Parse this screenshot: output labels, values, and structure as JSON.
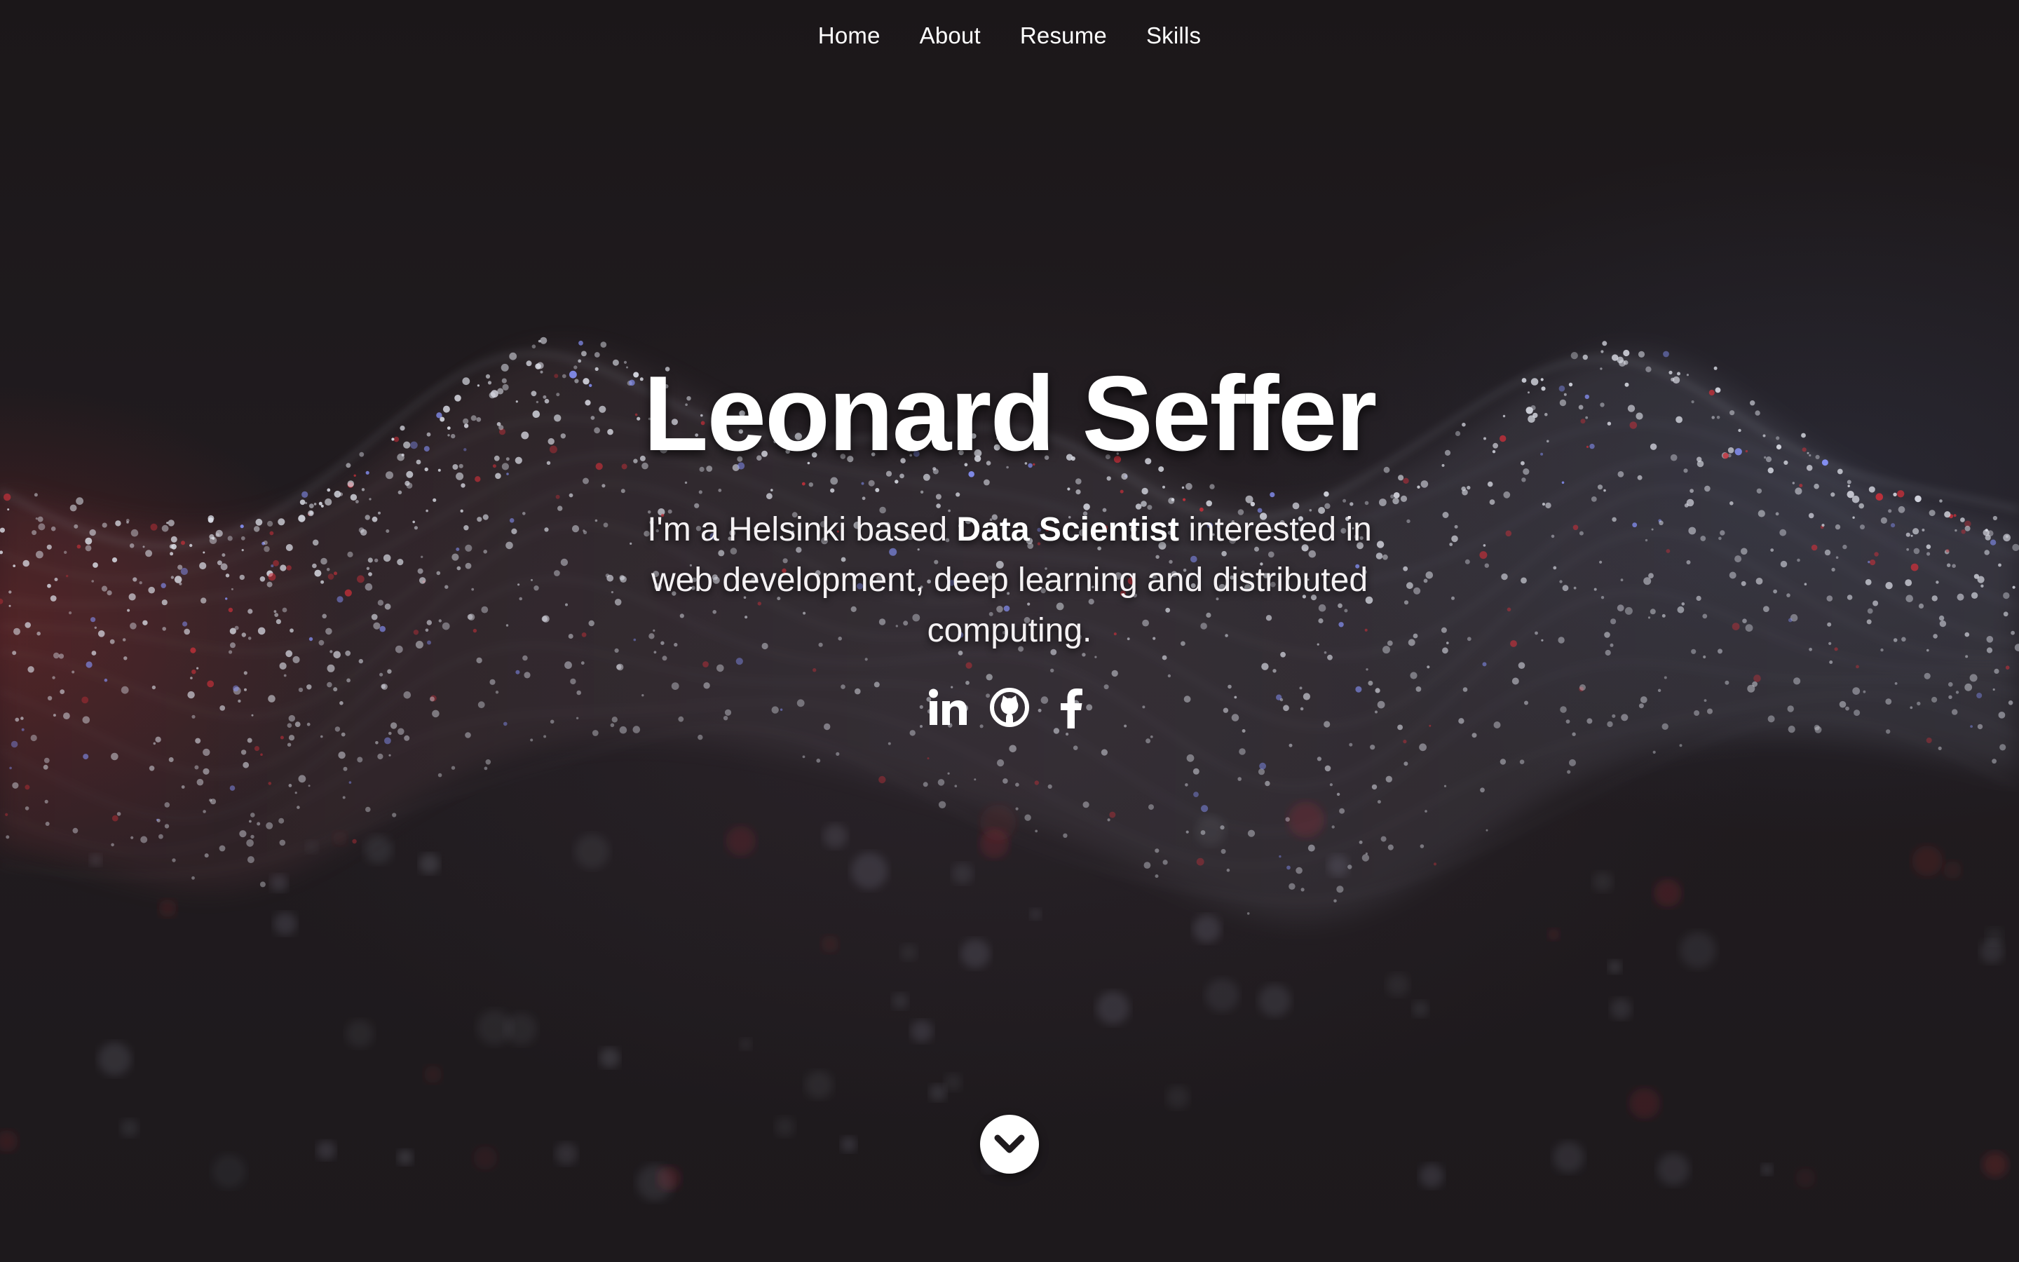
{
  "nav": {
    "items": [
      {
        "label": "Home"
      },
      {
        "label": "About"
      },
      {
        "label": "Resume"
      },
      {
        "label": "Skills"
      }
    ]
  },
  "banner": {
    "name": "Leonard Seffer",
    "intro_before": "I'm a Helsinki based ",
    "intro_emphasis": "Data Scientist",
    "intro_after": " interested in web development, deep learning and distributed computing."
  },
  "social": {
    "icons": [
      "linkedin-icon",
      "github-icon",
      "facebook-icon"
    ]
  },
  "scroll_down": {
    "icon": "chevron-down-icon"
  },
  "colors": {
    "background": "#1a1719",
    "text": "#ffffff",
    "particle_accent_red": "#c8303a",
    "particle_accent_blue": "#8a96ff"
  }
}
